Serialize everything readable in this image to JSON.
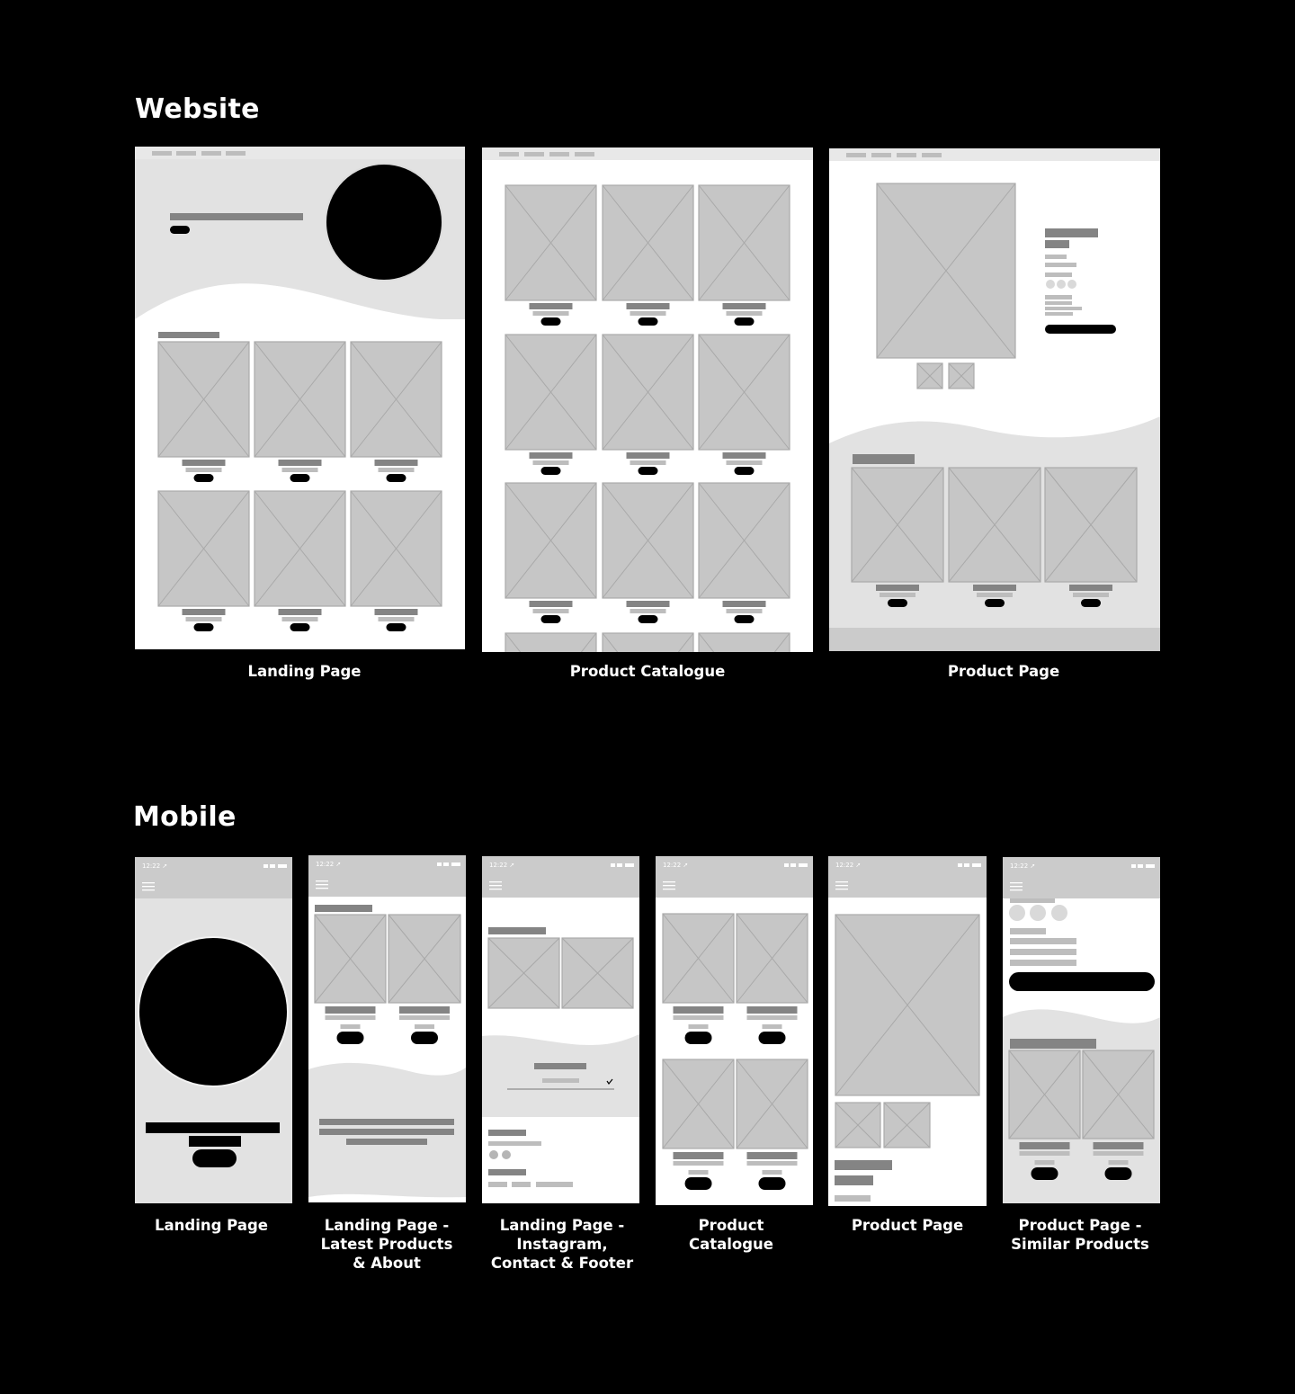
{
  "sections": {
    "website": {
      "title": "Website"
    },
    "mobile": {
      "title": "Mobile"
    }
  },
  "website_frames": [
    {
      "caption": "Landing Page"
    },
    {
      "caption": "Product Catalogue"
    },
    {
      "caption": "Product Page"
    }
  ],
  "mobile_frames": [
    {
      "caption": "Landing Page"
    },
    {
      "caption": "Landing Page -\nLatest Products\n& About"
    },
    {
      "caption": "Landing Page -\nInstagram,\nContact & Footer"
    },
    {
      "caption": "Product\nCatalogue"
    },
    {
      "caption": "Product Page"
    },
    {
      "caption": "Product Page -\nSimilar Products"
    }
  ],
  "status_bar": {
    "time": "12:22"
  },
  "colors": {
    "background": "#000000",
    "frame": "#ffffff",
    "wireframe_fill": "#c6c6c6",
    "wave": "#e2e2e2",
    "accent": "#000000"
  }
}
